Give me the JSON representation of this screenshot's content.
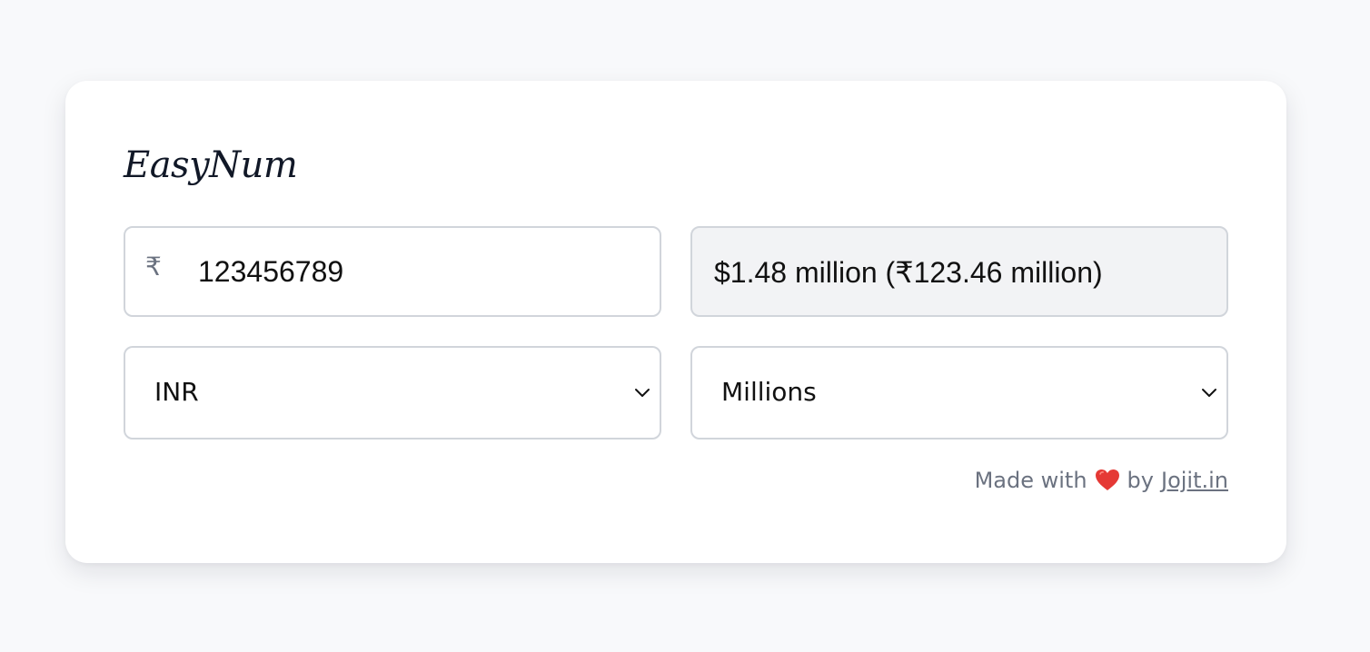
{
  "app": {
    "title": "EasyNum"
  },
  "amount": {
    "currency_symbol": "₹",
    "value": "123456789"
  },
  "result": {
    "text": "$1.48 million (₹123.46 million)"
  },
  "currency_select": {
    "selected": "INR"
  },
  "unit_select": {
    "selected": "Millions"
  },
  "footer": {
    "prefix": "Made with",
    "heart_icon": "heart-icon",
    "by": "by",
    "link_text": "Jojit.in"
  },
  "colors": {
    "page_bg": "#f8f9fb",
    "card_bg": "#ffffff",
    "border": "#d1d5db",
    "readonly_bg": "#f2f3f5",
    "heart": "#e53935",
    "muted_text": "#6b7280"
  }
}
